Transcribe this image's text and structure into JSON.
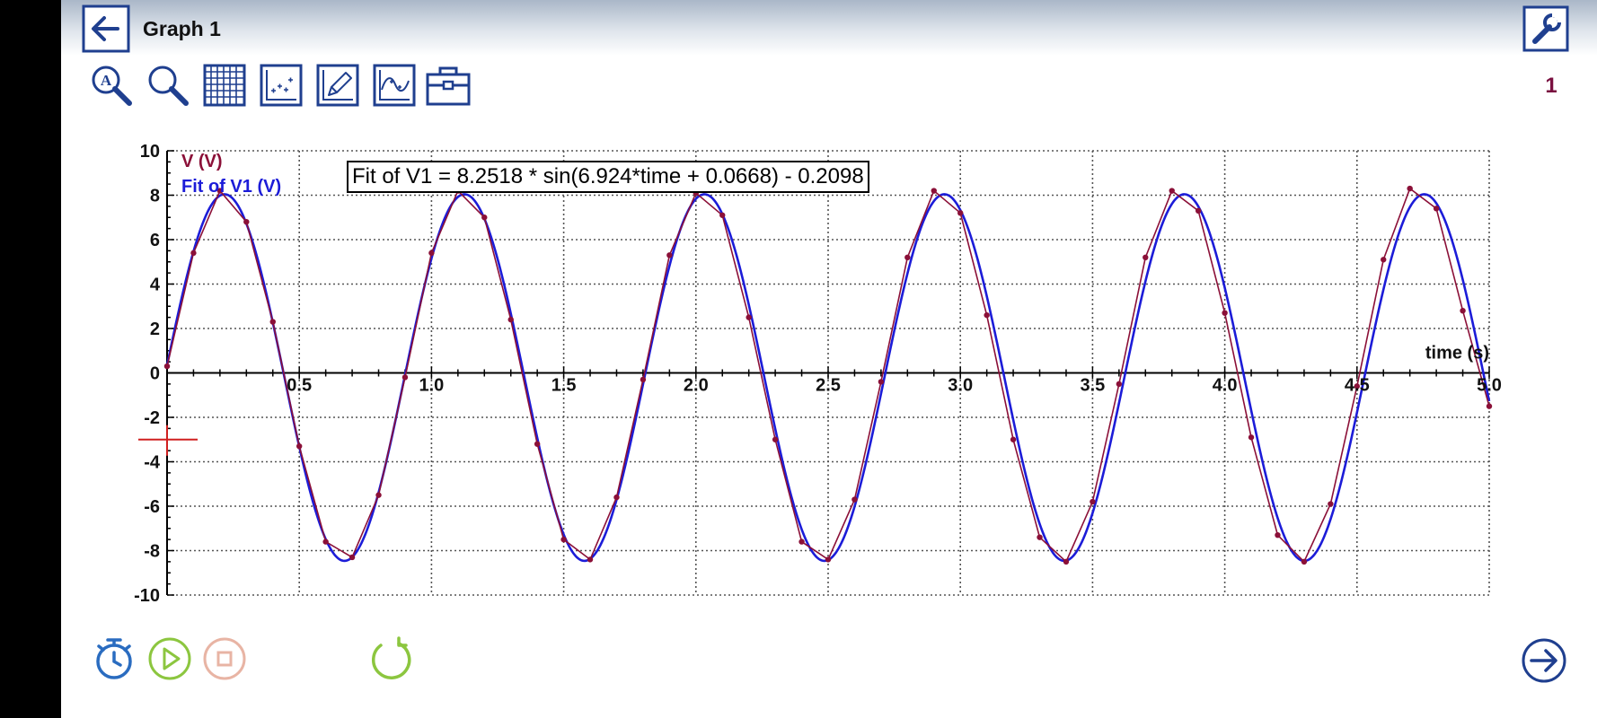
{
  "window": {
    "title": "Graph 1",
    "page_number": "1"
  },
  "toolbar": {
    "tools": [
      {
        "name": "autoscale-zoom-button",
        "icon": "autoscale-magnifier-icon"
      },
      {
        "name": "zoom-button",
        "icon": "magnifier-icon"
      },
      {
        "name": "grid-button",
        "icon": "grid-icon"
      },
      {
        "name": "point-style-button",
        "icon": "scatter-points-icon"
      },
      {
        "name": "draw-button",
        "icon": "pencil-icon"
      },
      {
        "name": "curve-fit-button",
        "icon": "curve-fit-icon"
      },
      {
        "name": "toolbox-button",
        "icon": "toolbox-icon"
      }
    ]
  },
  "annotation": {
    "fit_text": "Fit of V1 = 8.2518 * sin(6.924*time + 0.0668) - 0.2098"
  },
  "colors": {
    "data_series": "#8b1038",
    "fit_series": "#1c1cd8",
    "toolbar_icon": "#1f3f8f",
    "record_icon": "#2a6cc0",
    "play_icon": "#8cc63f",
    "stop_icon": "#e8b4a4",
    "cursor": "#d02020"
  },
  "chart_data": {
    "type": "line",
    "xlabel": "time (s)",
    "ylabel": "",
    "xlim": [
      0,
      5
    ],
    "ylim": [
      -10,
      10
    ],
    "grid": true,
    "legend_placement": "top-left",
    "x_ticks": [
      "0.5",
      "1.0",
      "1.5",
      "2.0",
      "2.5",
      "3.0",
      "3.5",
      "4.0",
      "4.5",
      "5.0"
    ],
    "y_ticks": [
      "10",
      "8",
      "6",
      "4",
      "2",
      "0",
      "-2",
      "-4",
      "-6",
      "-8",
      "-10"
    ],
    "series": [
      {
        "name": "V (V)",
        "kind": "data-points",
        "x": [
          0,
          0.1,
          0.2,
          0.3,
          0.4,
          0.5,
          0.6,
          0.7,
          0.8,
          0.9,
          1.0,
          1.1,
          1.2,
          1.3,
          1.4,
          1.5,
          1.6,
          1.7,
          1.8,
          1.9,
          2.0,
          2.1,
          2.2,
          2.3,
          2.4,
          2.5,
          2.6,
          2.7,
          2.8,
          2.9,
          3.0,
          3.1,
          3.2,
          3.3,
          3.4,
          3.5,
          3.6,
          3.7,
          3.8,
          3.9,
          4.0,
          4.1,
          4.2,
          4.3,
          4.4,
          4.5,
          4.6,
          4.7,
          4.8,
          4.9,
          5.0
        ],
        "y": [
          0.3,
          5.4,
          8.2,
          6.8,
          2.3,
          -3.3,
          -7.6,
          -8.3,
          -5.5,
          -0.2,
          5.4,
          8.2,
          7.0,
          2.4,
          -3.2,
          -7.5,
          -8.4,
          -5.6,
          -0.3,
          5.3,
          8.1,
          7.1,
          2.5,
          -3.0,
          -7.6,
          -8.4,
          -5.7,
          -0.4,
          5.2,
          8.2,
          7.2,
          2.6,
          -3.0,
          -7.4,
          -8.5,
          -5.8,
          -0.5,
          5.2,
          8.2,
          7.3,
          2.7,
          -2.9,
          -7.3,
          -8.5,
          -5.9,
          -0.6,
          5.1,
          8.3,
          7.4,
          2.8,
          -1.5
        ]
      },
      {
        "name": "Fit of V1 (V)",
        "kind": "fit-curve",
        "equation": {
          "A": 8.2518,
          "B": 6.924,
          "C": 0.0668,
          "D": -0.2098
        }
      }
    ]
  }
}
